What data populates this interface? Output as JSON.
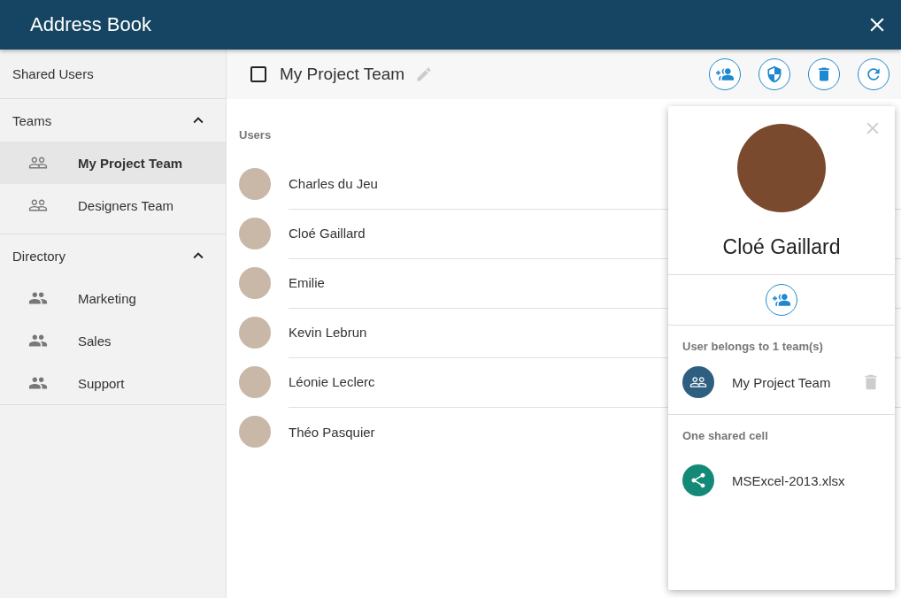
{
  "window": {
    "title": "Address Book"
  },
  "sidebar": {
    "top_item": {
      "label": "Shared Users"
    },
    "sections": [
      {
        "title": "Teams",
        "expanded": true,
        "items": [
          {
            "label": "My Project Team",
            "kind": "team",
            "selected": true
          },
          {
            "label": "Designers Team",
            "kind": "team",
            "selected": false
          }
        ]
      },
      {
        "title": "Directory",
        "expanded": true,
        "items": [
          {
            "label": "Marketing",
            "kind": "group",
            "selected": false
          },
          {
            "label": "Sales",
            "kind": "group",
            "selected": false
          },
          {
            "label": "Support",
            "kind": "group",
            "selected": false
          }
        ]
      }
    ]
  },
  "toolbar": {
    "checked": false,
    "title": "My Project Team"
  },
  "users": {
    "heading": "Users",
    "rows": [
      {
        "name": "Charles du Jeu"
      },
      {
        "name": "Cloé Gaillard"
      },
      {
        "name": "Emilie"
      },
      {
        "name": "Kevin Lebrun"
      },
      {
        "name": "Léonie Leclerc"
      },
      {
        "name": "Théo Pasquier"
      }
    ]
  },
  "user_card": {
    "name": "Cloé Gaillard",
    "teams_heading": "User belongs to 1 team(s)",
    "teams": [
      {
        "label": "My Project Team"
      }
    ],
    "cells_heading": "One shared cell",
    "cells": [
      {
        "label": "MSExcel-2013.xlsx"
      }
    ]
  }
}
